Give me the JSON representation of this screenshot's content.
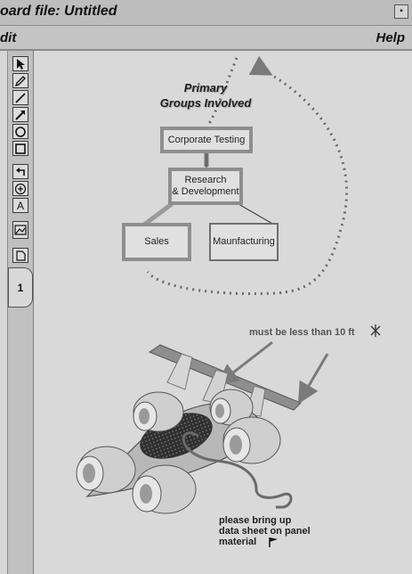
{
  "window": {
    "title": "oard file: Untitled",
    "control_glyph": "▪"
  },
  "menu": {
    "edit": "dit",
    "help": "Help"
  },
  "tools": [
    {
      "icon": "pointer-arrow-icon"
    },
    {
      "icon": "pencil-icon"
    },
    {
      "icon": "line-icon"
    },
    {
      "icon": "arrow-line-icon"
    },
    {
      "icon": "circle-icon"
    },
    {
      "icon": "rectangle-icon"
    },
    {
      "icon": "undo-icon"
    },
    {
      "icon": "stamp-icon"
    },
    {
      "icon": "text-tool-icon",
      "glyph": "A"
    },
    {
      "icon": "image-import-icon"
    },
    {
      "icon": "note-page-icon"
    }
  ],
  "page_tab": "1",
  "diagram": {
    "heading_line1": "Primary",
    "heading_line2": "Groups Involved",
    "nodes": {
      "corporate": "Corporate Testing",
      "rnd_line1": "Research",
      "rnd_line2": "& Development",
      "sales": "Sales",
      "manufacturing": "Maunfacturing"
    }
  },
  "annotations": {
    "length_note": "must be less than 10 ft",
    "panel_note_line1": "please bring up",
    "panel_note_line2": "data sheet on panel",
    "panel_note_line3": "material"
  },
  "colors": {
    "canvas": "#d9d9d9",
    "ink": "#6a6a6a",
    "hull": "#b8b8b8"
  }
}
